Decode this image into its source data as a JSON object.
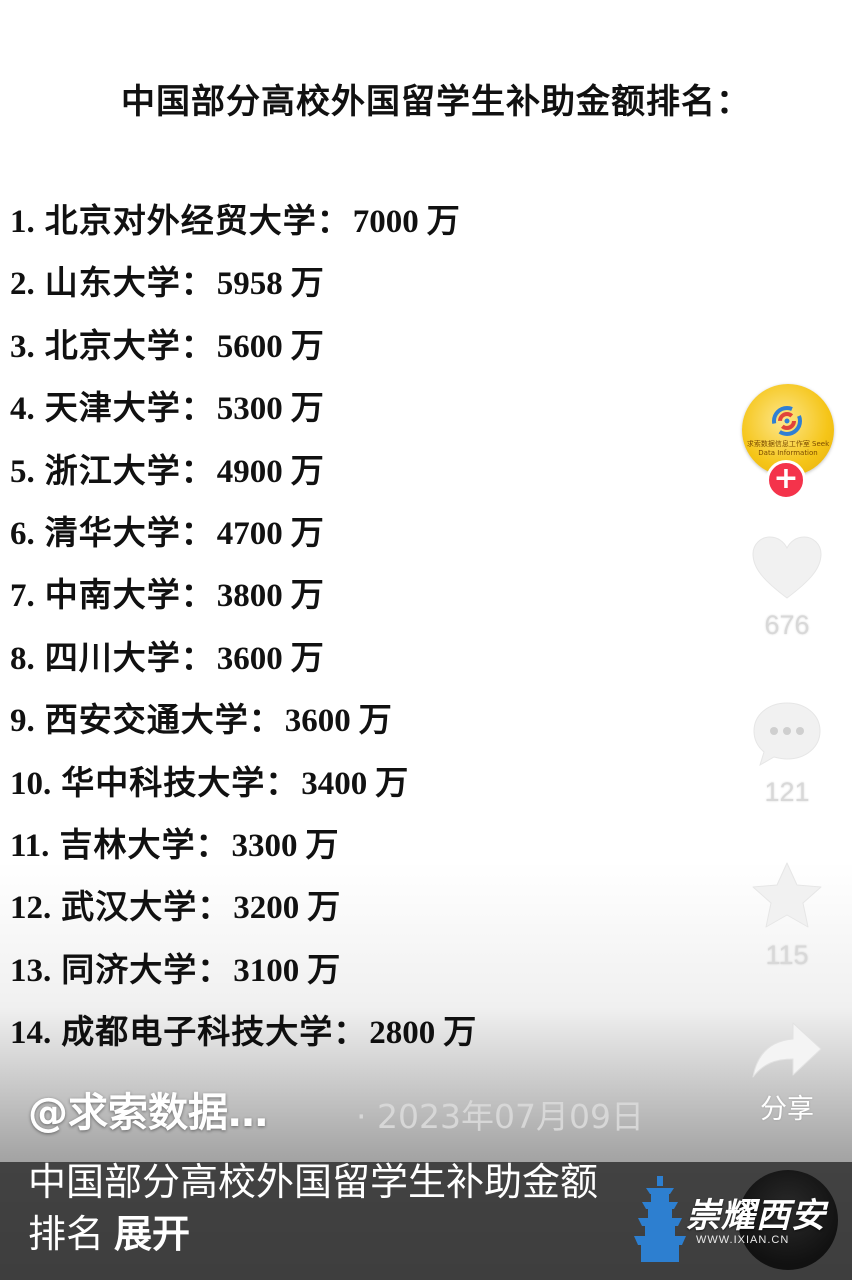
{
  "post": {
    "title": "中国部分高校外国留学生补助金额排名：",
    "unit": "万",
    "ranking": [
      {
        "num": "1.",
        "name": "北京对外经贸大学：",
        "amount": "7000"
      },
      {
        "num": "2.",
        "name": "山东大学：",
        "amount": "5958"
      },
      {
        "num": "3.",
        "name": "北京大学：",
        "amount": "5600"
      },
      {
        "num": "4.",
        "name": "天津大学：",
        "amount": "5300"
      },
      {
        "num": "5.",
        "name": "浙江大学：",
        "amount": "4900"
      },
      {
        "num": "6.",
        "name": "清华大学：",
        "amount": "4700"
      },
      {
        "num": "7.",
        "name": "中南大学：",
        "amount": "3800"
      },
      {
        "num": "8.",
        "name": "四川大学：",
        "amount": "3600"
      },
      {
        "num": "9.",
        "name": "西安交通大学：",
        "amount": "3600"
      },
      {
        "num": "10.",
        "name": "华中科技大学：",
        "amount": "3400"
      },
      {
        "num": "11.",
        "name": "吉林大学：",
        "amount": "3300"
      },
      {
        "num": "12.",
        "name": "武汉大学：",
        "amount": "3200"
      },
      {
        "num": "13.",
        "name": "同济大学：",
        "amount": "3100"
      },
      {
        "num": "14.",
        "name": "成都电子科技大学：",
        "amount": "2800"
      }
    ]
  },
  "sidebar": {
    "avatar_text": "求索数据信息工作室 Seek Data Information",
    "follow_icon": "plus-icon",
    "likes": "676",
    "comments": "121",
    "favorites": "115",
    "share_label": "分享",
    "icons": [
      "heart-icon",
      "comment-icon",
      "star-icon",
      "share-arrow-icon"
    ]
  },
  "footer": {
    "author": "@求索数据…",
    "date": "2023年07月09日",
    "caption": "中国部分高校外国留学生补助金额排名",
    "expand": "展开"
  },
  "watermark": {
    "text": "崇耀西安",
    "url": "WWW.IXIAN.CN"
  },
  "colors": {
    "follow_red": "#f4334b",
    "avatar_yellow": "#f5c518",
    "caption_panel": "#3a3a3a"
  }
}
